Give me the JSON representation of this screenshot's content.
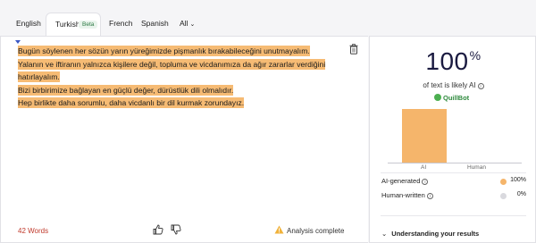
{
  "tabs": [
    {
      "label": "English"
    },
    {
      "label": "Turkish",
      "badge": "Beta",
      "active": true
    },
    {
      "label": "French"
    },
    {
      "label": "Spanish"
    },
    {
      "label": "All"
    }
  ],
  "editor": {
    "lines": [
      "Bugün söylenen her sözün yarın yüreğimizde pişmanlık bırakabileceğini unutmayalım.",
      "Yalanın ve iftiranın yalnızca kişilere değil, topluma ve vicdanımıza da ağır zararlar verdiğini",
      "hatırlayalım.",
      "Bizi birbirimize bağlayan en güçlü değer, dürüstlük  dili olmalıdır.",
      "Hep birlikte daha sorumlu, daha vicdanlı bir dil kurmak zorundayız."
    ],
    "word_count": "42 Words",
    "analysis_status": "Analysis complete"
  },
  "results": {
    "score": "100",
    "score_unit": "%",
    "caption": "of text is likely AI",
    "brand": "QuillBot",
    "chart_data": {
      "type": "bar",
      "categories": [
        "AI",
        "Human"
      ],
      "values": [
        100,
        0
      ],
      "ylim": [
        0,
        100
      ]
    },
    "rows": [
      {
        "label": "AI-generated",
        "value": "100%",
        "color": "#f5b56b"
      },
      {
        "label": "Human-written",
        "value": "0%",
        "color": "#d9d9de"
      }
    ],
    "understanding": "Understanding your results"
  }
}
